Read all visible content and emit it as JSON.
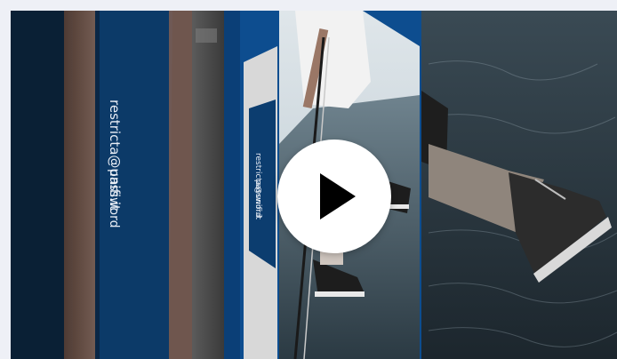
{
  "video": {
    "login_email": "restricta@unifi.it",
    "login_password": "password",
    "login_email_small": "restricta@unifi.it",
    "login_password_small": "password"
  },
  "controls": {
    "play_icon": "play-icon",
    "play_color": "#000000"
  },
  "colors": {
    "blue_panel": "#0d4d8f",
    "dark_navy": "#0b2440",
    "page_bg": "#eef0f6"
  }
}
